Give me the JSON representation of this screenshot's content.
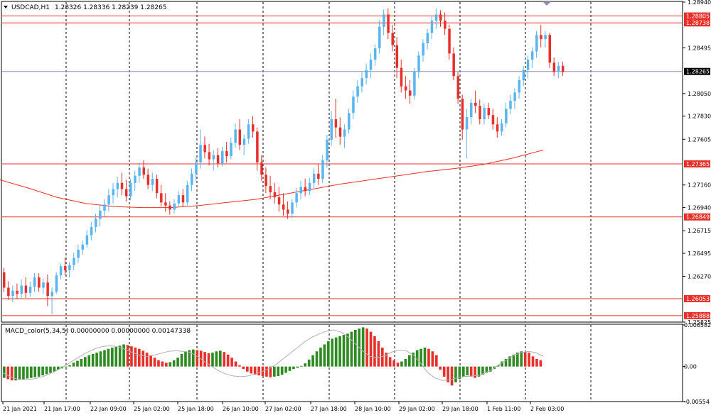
{
  "main_pane": {
    "symbol_label": "USDCAD,H1",
    "ohlc_label": "1.28326 1.28336 1.28239 1.28265",
    "menu_icon": "triangle-down-icon",
    "colors": {
      "bull": "#5ab4ee",
      "bear": "#e8302a",
      "hline": "#e8302a",
      "ma": "#e8302a",
      "current_line": "#8a8fb5",
      "grid": "#000000"
    }
  },
  "macd_pane": {
    "title": "MACD_color(5,34,5) 0.00000000 0.00000000 0.00147338",
    "colors": {
      "up": "#2e8b22",
      "down": "#e8302a",
      "signal": "#b0b0b0"
    }
  },
  "chart_data": {
    "type": "candlestick",
    "symbol": "USDCAD",
    "timeframe": "H1",
    "grid": true,
    "price_ticks": [
      "1.28940",
      "1.28495",
      "1.28050",
      "1.27830",
      "1.27605",
      "1.27160",
      "1.26940",
      "1.26715",
      "1.26495",
      "1.26270",
      "1.25825"
    ],
    "ylim": [
      1.25825,
      1.2894
    ],
    "time_labels": [
      "21 Jan 2021",
      "21 Jan 17:00",
      "22 Jan 09:00",
      "25 Jan 02:00",
      "25 Jan 18:00",
      "26 Jan 10:00",
      "27 Jan 02:00",
      "27 Jan 18:00",
      "28 Jan 10:00",
      "29 Jan 02:00",
      "29 Jan 18:00",
      "1 Feb 11:00",
      "2 Feb 03:00"
    ],
    "horizontal_levels": [
      {
        "label": "1.28805",
        "value": 1.28805
      },
      {
        "label": "1.28738",
        "value": 1.28738
      },
      {
        "label": "1.27365",
        "value": 1.27365
      },
      {
        "label": "1.26849",
        "value": 1.26849
      },
      {
        "label": "1.26053",
        "value": 1.26053
      },
      {
        "label": "1.25888",
        "value": 1.25888
      }
    ],
    "current_price": {
      "label": "1.28265",
      "value": 1.28265
    },
    "moving_average": {
      "values": [
        [
          0,
          1.2721
        ],
        [
          40,
          1.2713
        ],
        [
          80,
          1.2704
        ],
        [
          120,
          1.2698
        ],
        [
          160,
          1.2695
        ],
        [
          200,
          1.2694
        ],
        [
          240,
          1.2694
        ],
        [
          280,
          1.2696
        ],
        [
          320,
          1.2699
        ],
        [
          360,
          1.2702
        ],
        [
          400,
          1.2707
        ],
        [
          440,
          1.2712
        ],
        [
          480,
          1.2717
        ],
        [
          520,
          1.2721
        ],
        [
          560,
          1.2725
        ],
        [
          600,
          1.2729
        ],
        [
          640,
          1.2732
        ],
        [
          680,
          1.2736
        ],
        [
          720,
          1.2742
        ],
        [
          764,
          1.275
        ]
      ]
    },
    "candles": [
      [
        1.2631,
        1.2635,
        1.2612,
        1.2616
      ],
      [
        1.2616,
        1.2622,
        1.2604,
        1.2608
      ],
      [
        1.2608,
        1.2618,
        1.2602,
        1.2613
      ],
      [
        1.2613,
        1.262,
        1.2605,
        1.261
      ],
      [
        1.261,
        1.2624,
        1.2605,
        1.2618
      ],
      [
        1.2618,
        1.2626,
        1.2606,
        1.2611
      ],
      [
        1.2611,
        1.2622,
        1.2607,
        1.2617
      ],
      [
        1.2617,
        1.263,
        1.2612,
        1.2626
      ],
      [
        1.2626,
        1.263,
        1.2612,
        1.2616
      ],
      [
        1.2616,
        1.2625,
        1.261,
        1.2621
      ],
      [
        1.2621,
        1.2629,
        1.2598,
        1.2608
      ],
      [
        1.2608,
        1.2616,
        1.259,
        1.2612
      ],
      [
        1.2612,
        1.2631,
        1.261,
        1.2628
      ],
      [
        1.2628,
        1.264,
        1.2624,
        1.2637
      ],
      [
        1.2637,
        1.2645,
        1.2628,
        1.2633
      ],
      [
        1.2633,
        1.2641,
        1.2626,
        1.2638
      ],
      [
        1.2638,
        1.265,
        1.2633,
        1.2645
      ],
      [
        1.2645,
        1.2658,
        1.264,
        1.2653
      ],
      [
        1.2653,
        1.2662,
        1.2648,
        1.2658
      ],
      [
        1.2658,
        1.2672,
        1.2655,
        1.2667
      ],
      [
        1.2667,
        1.268,
        1.2662,
        1.2675
      ],
      [
        1.2675,
        1.2688,
        1.267,
        1.2683
      ],
      [
        1.2683,
        1.2697,
        1.2676,
        1.2691
      ],
      [
        1.2691,
        1.2702,
        1.2685,
        1.2697
      ],
      [
        1.2697,
        1.2712,
        1.269,
        1.2706
      ],
      [
        1.2706,
        1.2718,
        1.2698,
        1.2712
      ],
      [
        1.2712,
        1.2724,
        1.2704,
        1.2718
      ],
      [
        1.2718,
        1.2728,
        1.2706,
        1.2712
      ],
      [
        1.2712,
        1.2721,
        1.27,
        1.2705
      ],
      [
        1.2705,
        1.2722,
        1.2701,
        1.2718
      ],
      [
        1.2718,
        1.273,
        1.271,
        1.2725
      ],
      [
        1.2725,
        1.2738,
        1.2718,
        1.2733
      ],
      [
        1.2733,
        1.274,
        1.2722,
        1.2726
      ],
      [
        1.2726,
        1.2732,
        1.2712,
        1.2716
      ],
      [
        1.2716,
        1.2728,
        1.271,
        1.2722
      ],
      [
        1.2722,
        1.2726,
        1.2703,
        1.2708
      ],
      [
        1.2708,
        1.2716,
        1.2695,
        1.2699
      ],
      [
        1.2699,
        1.2708,
        1.269,
        1.2696
      ],
      [
        1.2696,
        1.27,
        1.2687,
        1.2692
      ],
      [
        1.2692,
        1.2702,
        1.2688,
        1.2698
      ],
      [
        1.2698,
        1.271,
        1.2694,
        1.2706
      ],
      [
        1.2706,
        1.2712,
        1.2695,
        1.2699
      ],
      [
        1.2699,
        1.272,
        1.2696,
        1.2716
      ],
      [
        1.2716,
        1.2732,
        1.271,
        1.2727
      ],
      [
        1.2727,
        1.2743,
        1.272,
        1.2738
      ],
      [
        1.2738,
        1.277,
        1.2732,
        1.2755
      ],
      [
        1.2755,
        1.2763,
        1.2742,
        1.2748
      ],
      [
        1.2748,
        1.2756,
        1.2735,
        1.2741
      ],
      [
        1.2741,
        1.275,
        1.273,
        1.2745
      ],
      [
        1.2745,
        1.2752,
        1.2733,
        1.2737
      ],
      [
        1.2737,
        1.2753,
        1.2734,
        1.2749
      ],
      [
        1.2749,
        1.2758,
        1.2738,
        1.2744
      ],
      [
        1.2744,
        1.2762,
        1.2741,
        1.2757
      ],
      [
        1.2757,
        1.2776,
        1.2752,
        1.277
      ],
      [
        1.277,
        1.278,
        1.275,
        1.2755
      ],
      [
        1.2755,
        1.2765,
        1.2745,
        1.2761
      ],
      [
        1.2761,
        1.278,
        1.2756,
        1.2775
      ],
      [
        1.2775,
        1.2783,
        1.2762,
        1.2768
      ],
      [
        1.2768,
        1.2772,
        1.273,
        1.2738
      ],
      [
        1.2738,
        1.2745,
        1.272,
        1.2726
      ],
      [
        1.2726,
        1.2733,
        1.2708,
        1.2715
      ],
      [
        1.2715,
        1.2725,
        1.2702,
        1.2709
      ],
      [
        1.2709,
        1.2718,
        1.2698,
        1.2704
      ],
      [
        1.2704,
        1.2714,
        1.269,
        1.2697
      ],
      [
        1.2697,
        1.2708,
        1.2686,
        1.2692
      ],
      [
        1.2692,
        1.27,
        1.2683,
        1.2688
      ],
      [
        1.2688,
        1.2702,
        1.2684,
        1.2699
      ],
      [
        1.2699,
        1.2713,
        1.2694,
        1.2708
      ],
      [
        1.2708,
        1.272,
        1.2702,
        1.2714
      ],
      [
        1.2714,
        1.2722,
        1.2705,
        1.271
      ],
      [
        1.271,
        1.2723,
        1.2706,
        1.2718
      ],
      [
        1.2718,
        1.2732,
        1.2713,
        1.2727
      ],
      [
        1.2727,
        1.2736,
        1.2716,
        1.2722
      ],
      [
        1.2722,
        1.2745,
        1.2718,
        1.274
      ],
      [
        1.274,
        1.2765,
        1.2733,
        1.276
      ],
      [
        1.276,
        1.2788,
        1.2754,
        1.278
      ],
      [
        1.278,
        1.28,
        1.2762,
        1.2772
      ],
      [
        1.2772,
        1.2782,
        1.2755,
        1.2763
      ],
      [
        1.2763,
        1.2775,
        1.2752,
        1.277
      ],
      [
        1.277,
        1.279,
        1.2766,
        1.2786
      ],
      [
        1.2786,
        1.2808,
        1.278,
        1.2802
      ],
      [
        1.2802,
        1.2818,
        1.2796,
        1.2812
      ],
      [
        1.2812,
        1.2826,
        1.2806,
        1.282
      ],
      [
        1.282,
        1.2834,
        1.2814,
        1.2828
      ],
      [
        1.2828,
        1.2844,
        1.282,
        1.2838
      ],
      [
        1.2838,
        1.2853,
        1.2832,
        1.2849
      ],
      [
        1.2849,
        1.2876,
        1.2844,
        1.287
      ],
      [
        1.287,
        1.2887,
        1.2862,
        1.2882
      ],
      [
        1.2882,
        1.2888,
        1.2858,
        1.2864
      ],
      [
        1.2864,
        1.2872,
        1.2846,
        1.2852
      ],
      [
        1.2852,
        1.286,
        1.282,
        1.283
      ],
      [
        1.283,
        1.2838,
        1.2806,
        1.2812
      ],
      [
        1.2812,
        1.2822,
        1.28,
        1.2808
      ],
      [
        1.2808,
        1.2818,
        1.2795,
        1.2803
      ],
      [
        1.2803,
        1.283,
        1.2799,
        1.2826
      ],
      [
        1.2826,
        1.2846,
        1.282,
        1.2842
      ],
      [
        1.2842,
        1.2858,
        1.2836,
        1.2854
      ],
      [
        1.2854,
        1.2868,
        1.2848,
        1.2864
      ],
      [
        1.2864,
        1.288,
        1.2858,
        1.2876
      ],
      [
        1.2876,
        1.2888,
        1.2868,
        1.2882
      ],
      [
        1.2882,
        1.2886,
        1.287,
        1.2876
      ],
      [
        1.2876,
        1.2884,
        1.2862,
        1.2868
      ],
      [
        1.2868,
        1.2872,
        1.2838,
        1.2844
      ],
      [
        1.2844,
        1.285,
        1.2818,
        1.2822
      ],
      [
        1.2822,
        1.2826,
        1.2795,
        1.28
      ],
      [
        1.28,
        1.2804,
        1.276,
        1.277
      ],
      [
        1.277,
        1.279,
        1.2742,
        1.2782
      ],
      [
        1.2782,
        1.28,
        1.2775,
        1.2796
      ],
      [
        1.2796,
        1.2808,
        1.2786,
        1.2793
      ],
      [
        1.2793,
        1.2799,
        1.2775,
        1.278
      ],
      [
        1.278,
        1.2795,
        1.2775,
        1.2791
      ],
      [
        1.2791,
        1.2796,
        1.278,
        1.2784
      ],
      [
        1.2784,
        1.279,
        1.277,
        1.2775
      ],
      [
        1.2775,
        1.2782,
        1.2762,
        1.2768
      ],
      [
        1.2768,
        1.278,
        1.2764,
        1.2776
      ],
      [
        1.2776,
        1.2796,
        1.2772,
        1.279
      ],
      [
        1.279,
        1.2804,
        1.2785,
        1.2798
      ],
      [
        1.2798,
        1.281,
        1.279,
        1.2806
      ],
      [
        1.2806,
        1.2822,
        1.28,
        1.2818
      ],
      [
        1.2818,
        1.2832,
        1.2812,
        1.2828
      ],
      [
        1.2828,
        1.2842,
        1.282,
        1.2838
      ],
      [
        1.2838,
        1.285,
        1.283,
        1.2846
      ],
      [
        1.2846,
        1.2866,
        1.284,
        1.2862
      ],
      [
        1.2862,
        1.2872,
        1.285,
        1.2858
      ],
      [
        1.2858,
        1.2866,
        1.285,
        1.2862
      ],
      [
        1.2862,
        1.2864,
        1.283,
        1.2835
      ],
      [
        1.2835,
        1.284,
        1.2822,
        1.2826
      ],
      [
        1.2826,
        1.2836,
        1.282,
        1.2832
      ],
      [
        1.2832,
        1.2836,
        1.2822,
        1.2826
      ]
    ],
    "macd": {
      "ylim": [
        -0.00554,
        0.00658
      ],
      "ticks": [
        "0.006582",
        "0.00",
        "-0.00554"
      ],
      "histogram": [
        -0.0018,
        -0.002,
        -0.0022,
        -0.0022,
        -0.0021,
        -0.002,
        -0.0019,
        -0.0018,
        -0.0017,
        -0.0016,
        -0.0014,
        -0.0012,
        -0.001,
        -0.0008,
        -0.0005,
        -0.0003,
        -0.0001,
        0.0002,
        0.0006,
        0.0009,
        0.0012,
        0.0015,
        0.0018,
        0.002,
        0.0022,
        0.0024,
        0.0026,
        0.0028,
        0.003,
        0.0031,
        0.0033,
        0.0035,
        0.0034,
        0.0032,
        0.003,
        0.0028,
        0.0025,
        0.0022,
        0.0018,
        0.0014,
        0.001,
        0.0008,
        0.0006,
        0.0007,
        0.001,
        0.0014,
        0.002,
        0.0024,
        0.0026,
        0.0027,
        0.0026,
        0.0025,
        0.0023,
        0.0021,
        0.0022,
        0.0024,
        0.0025,
        0.0023,
        0.0019,
        0.0014,
        0.0008,
        0.0002,
        -0.0004,
        -0.0008,
        -0.0011,
        -0.0013,
        -0.0014,
        -0.0015,
        -0.0016,
        -0.0017,
        -0.0016,
        -0.0015,
        -0.0013,
        -0.001,
        -0.0007,
        -0.0004,
        -0.0002,
        0.0001,
        0.0005,
        0.0011,
        0.0018,
        0.0024,
        0.003,
        0.0035,
        0.004,
        0.0044,
        0.0046,
        0.0048,
        0.005,
        0.0052,
        0.0055,
        0.0058,
        0.006,
        0.0062,
        0.006,
        0.0055,
        0.0048,
        0.004,
        0.003,
        0.0022,
        0.0015,
        0.001,
        0.0006,
        0.0008,
        0.0012,
        0.0018,
        0.0022,
        0.0026,
        0.0028,
        0.003,
        0.0028,
        0.0024,
        0.0018,
        -0.0005,
        -0.0016,
        -0.0025,
        -0.003,
        -0.0025,
        -0.002,
        -0.0016,
        -0.0014,
        -0.0016,
        -0.0018,
        -0.0016,
        -0.0013,
        -0.001,
        -0.0008,
        -0.0004,
        0.0002,
        0.0008,
        0.0012,
        0.0016,
        0.0019,
        0.0022,
        0.0024,
        0.0023,
        0.0022,
        0.0016,
        0.0012,
        0.001
      ],
      "signal": [
        -0.001,
        -0.0016,
        -0.002,
        -0.0021,
        -0.002,
        -0.0018,
        -0.0014,
        -0.0009,
        -0.0003,
        0.0004,
        0.0011,
        0.0018,
        0.0024,
        0.0029,
        0.0032,
        0.0033,
        0.0031,
        0.0027,
        0.0022,
        0.0018,
        0.0016,
        0.0018,
        0.0021,
        0.0024,
        0.0025,
        0.0024,
        0.0022,
        0.0016,
        0.0008,
        0.0,
        -0.0007,
        -0.0012,
        -0.0015,
        -0.0016,
        -0.0015,
        -0.0012,
        -0.0008,
        -0.0003,
        0.0004,
        0.0013,
        0.0022,
        0.0031,
        0.004,
        0.0047,
        0.0052,
        0.0056,
        0.0058,
        0.0054,
        0.0046,
        0.0035,
        0.0024,
        0.0016,
        0.0014,
        0.0017,
        0.0023,
        0.0026,
        0.0025,
        0.0018,
        0.0005,
        -0.001,
        -0.0018,
        -0.0022,
        -0.0021,
        -0.0018,
        -0.0016,
        -0.0015,
        -0.0014,
        -0.001,
        -0.0004,
        0.0004,
        0.0011,
        0.0018,
        0.0022,
        0.0024,
        0.0022,
        0.0016
      ]
    }
  }
}
